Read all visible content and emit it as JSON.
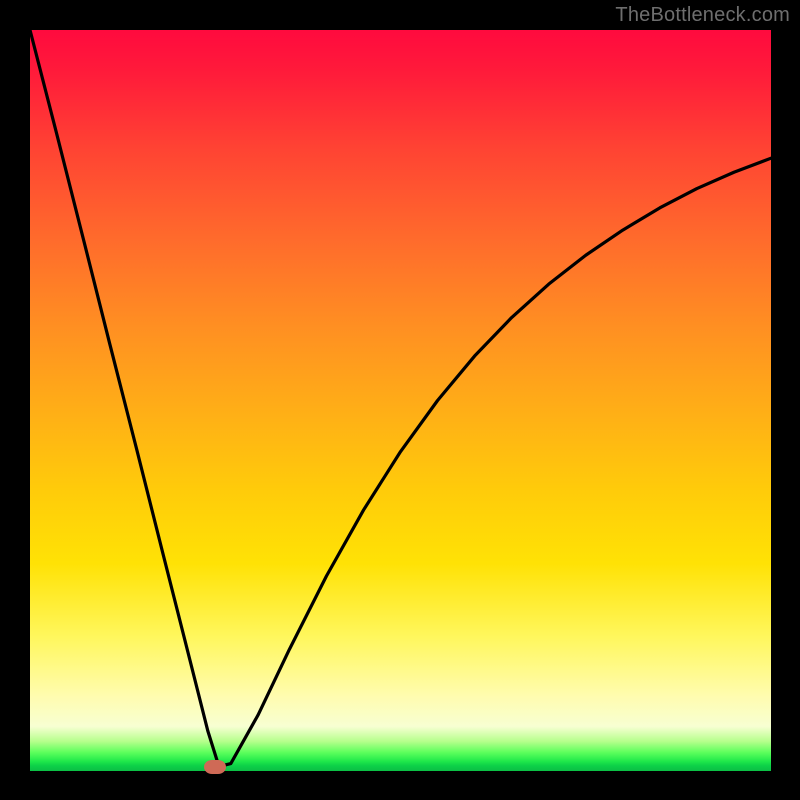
{
  "watermark": "TheBottleneck.com",
  "colors": {
    "frame": "#000000",
    "gradient_top": "#ff0a3e",
    "gradient_mid": "#ffcb0a",
    "gradient_bottom": "#0bbf45",
    "curve_stroke": "#000000",
    "marker_fill": "#cf6a56",
    "watermark_color": "#6e6e6e"
  },
  "chart_data": {
    "type": "line",
    "title": "",
    "xlabel": "",
    "ylabel": "",
    "xlim": [
      0,
      100
    ],
    "ylim": [
      0,
      100
    ],
    "grid": false,
    "legend": false,
    "series": [
      {
        "name": "curve",
        "x": [
          0.0,
          3.6,
          7.2,
          10.8,
          14.4,
          18.0,
          21.6,
          24.0,
          25.5,
          27.1,
          30.8,
          35.0,
          40.0,
          45.0,
          50.0,
          55.0,
          60.0,
          65.0,
          70.0,
          75.0,
          80.0,
          85.0,
          90.0,
          95.0,
          100.0
        ],
        "y": [
          100.0,
          86.0,
          71.8,
          57.5,
          43.4,
          29.1,
          14.9,
          5.4,
          0.6,
          1.0,
          7.6,
          16.4,
          26.3,
          35.2,
          43.1,
          50.0,
          56.0,
          61.2,
          65.7,
          69.6,
          73.0,
          76.0,
          78.6,
          80.8,
          82.7
        ]
      }
    ],
    "marker": {
      "x": 25.0,
      "y": 0.6
    },
    "background_gradient_stops": [
      {
        "pos": 0.0,
        "color": "#ff0a3e"
      },
      {
        "pos": 0.5,
        "color": "#ffcb0a"
      },
      {
        "pos": 0.92,
        "color": "#fffcb0"
      },
      {
        "pos": 1.0,
        "color": "#0bbf45"
      }
    ]
  }
}
